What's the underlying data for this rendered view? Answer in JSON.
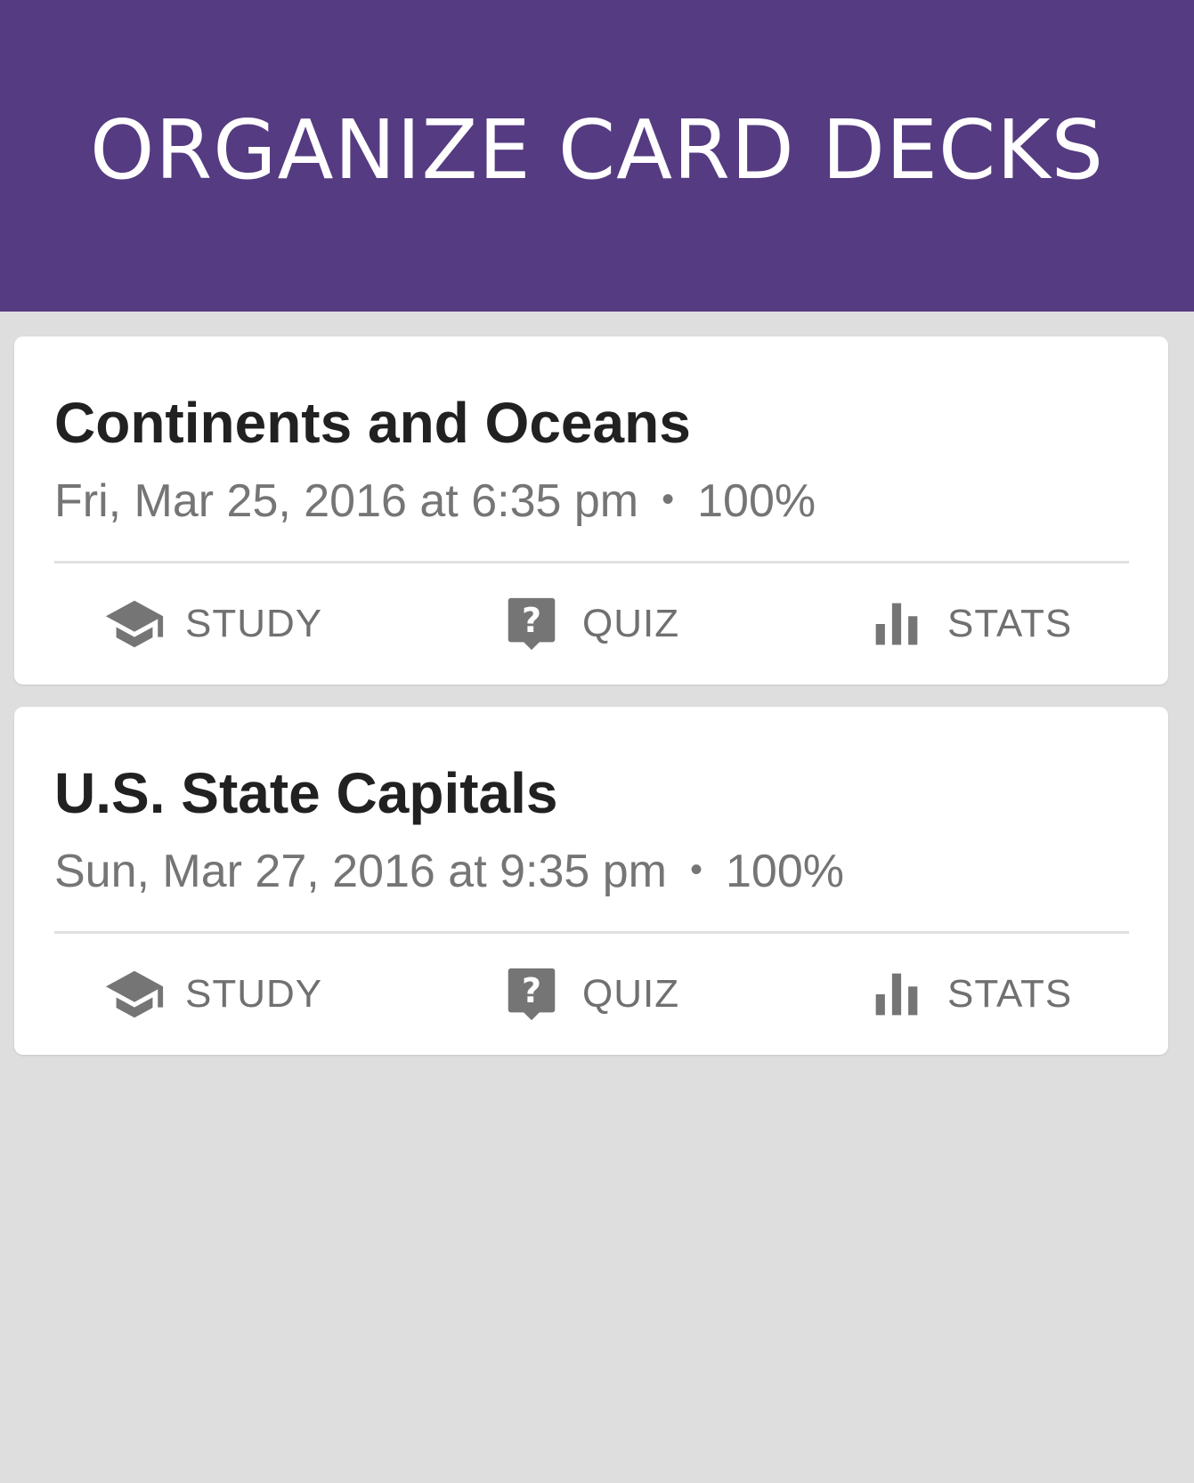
{
  "header": {
    "title": "ORGANIZE CARD DECKS",
    "background_color": "#553b81"
  },
  "decks": [
    {
      "title": "Continents and Oceans",
      "date": "Fri, Mar 25, 2016 at 6:35 pm",
      "separator": "•",
      "score": "100%",
      "actions": {
        "study": {
          "label": "STUDY",
          "icon": "graduation-cap-icon"
        },
        "quiz": {
          "label": "QUIZ",
          "icon": "question-mark-icon"
        },
        "stats": {
          "label": "STATS",
          "icon": "bar-chart-icon"
        }
      }
    },
    {
      "title": "U.S. State Capitals",
      "date": "Sun, Mar 27, 2016 at 9:35 pm",
      "separator": "•",
      "score": "100%",
      "actions": {
        "study": {
          "label": "STUDY",
          "icon": "graduation-cap-icon"
        },
        "quiz": {
          "label": "QUIZ",
          "icon": "question-mark-icon"
        },
        "stats": {
          "label": "STATS",
          "icon": "bar-chart-icon"
        }
      }
    }
  ]
}
